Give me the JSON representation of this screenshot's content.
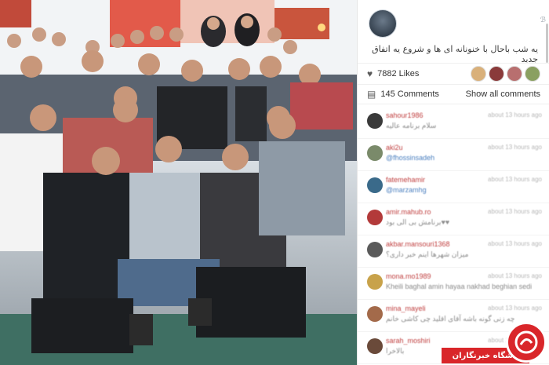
{
  "post": {
    "caption": "یه شب باحال با خنونانه ای ها و شروع یه اتفاق جدید",
    "corner_glyph": "ℬ",
    "likes_label": "7882 Likes",
    "comments_count_label": "145 Comments",
    "show_all_label": "Show all comments"
  },
  "likers": [
    {
      "color": "#d9b07a"
    },
    {
      "color": "#8a3a3a"
    },
    {
      "color": "#b86f6f"
    },
    {
      "color": "#8aa061"
    }
  ],
  "comments": [
    {
      "user": "sahour1986",
      "time": "about 13 hours ago",
      "text": "سلام برنامه عالیه",
      "mention": false,
      "avatar": "#3a3a3a"
    },
    {
      "user": "aki2u",
      "time": "about 13 hours ago",
      "text": "@fhossinsadeh",
      "mention": true,
      "avatar": "#7a8a6a"
    },
    {
      "user": "fatemehamir",
      "time": "about 13 hours ago",
      "text": "@marzamhg",
      "mention": true,
      "avatar": "#3a6a8a"
    },
    {
      "user": "amir.mahub.ro",
      "time": "about 13 hours ago",
      "text": "برنامش بی الی بود♥♥",
      "mention": false,
      "avatar": "#b33a3a"
    },
    {
      "user": "akbar.mansouri1368",
      "time": "about 13 hours ago",
      "text": "میزان شهرها اینم خبر داری؟",
      "mention": false,
      "avatar": "#5a5a5a"
    },
    {
      "user": "mona.mo1989",
      "time": "about 13 hours ago",
      "text": "Kheili baghal amin hayaa nakhad beghian sedi",
      "mention": false,
      "avatar": "#c8a24a"
    },
    {
      "user": "mina_mayeli",
      "time": "about 13 hours ago",
      "text": "چه زنی گونه باشه آقای اقلید چی کاشی خانم",
      "mention": false,
      "avatar": "#a36a4a"
    },
    {
      "user": "sarah_moshiri",
      "time": "about 13 hours ago",
      "text": "بالاخرا",
      "mention": false,
      "avatar": "#6a4a3a"
    }
  ],
  "watermark": {
    "text": "باشگاه خبرنگاران"
  },
  "colors": {
    "brand_red": "#d9262a",
    "username_red": "#c04040",
    "mention_blue": "#4a7fbf"
  },
  "icons": {
    "likes": "heart-icon",
    "comments": "comment-icon"
  }
}
